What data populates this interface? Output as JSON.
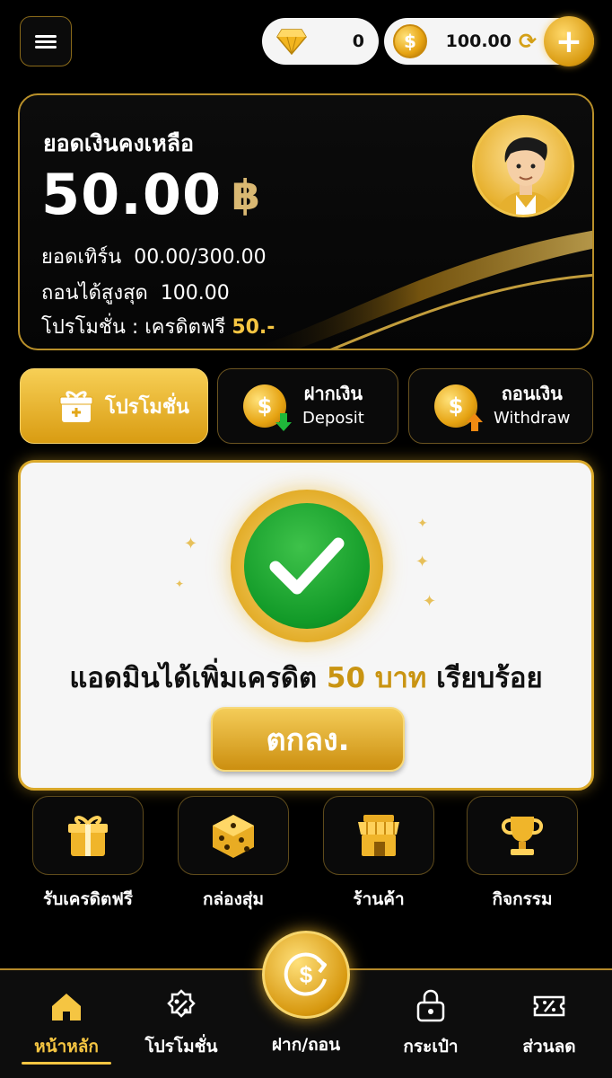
{
  "topbar": {
    "gems": "0",
    "coins": "100.00",
    "menu_icon": "hamburger-menu-icon",
    "refresh_icon": "refresh-icon",
    "plus_icon": "plus-icon",
    "coin_symbol": "$"
  },
  "balance_card": {
    "title": "ยอดเงินคงเหลือ",
    "amount": "50.00",
    "currency": "฿",
    "turnover_label": "ยอดเทิร์น",
    "turnover_value": "00.00/300.00",
    "max_withdraw_label": "ถอนได้สูงสุด",
    "max_withdraw_value": "100.00",
    "promo_label": "โปรโมชั่น : เครดิตฟรี",
    "promo_value": "50.-"
  },
  "actions": {
    "promo": "โปรโมชั่น",
    "deposit_th": "ฝากเงิน",
    "deposit_en": "Deposit",
    "withdraw_th": "ถอนเงิน",
    "withdraw_en": "Withdraw"
  },
  "modal": {
    "msg_pre": "แอดมินได้เพิ่มเครดิต",
    "msg_amount": "50 บาท",
    "msg_post": "เรียบร้อย",
    "ok": "ตกลง."
  },
  "quick": [
    {
      "label": "รับเครดิตฟรี",
      "icon": "gift-icon"
    },
    {
      "label": "กล่องสุ่ม",
      "icon": "dice-icon"
    },
    {
      "label": "ร้านค้า",
      "icon": "shop-icon"
    },
    {
      "label": "กิจกรรม",
      "icon": "trophy-icon"
    }
  ],
  "nav": {
    "home": "หน้าหลัก",
    "promo": "โปรโมชั่น",
    "deposit_withdraw": "ฝาก/ถอน",
    "wallet": "กระเป๋า",
    "discount": "ส่วนลด"
  },
  "colors": {
    "gold": "#f5c542",
    "bg": "#000000",
    "success": "#129a28"
  }
}
